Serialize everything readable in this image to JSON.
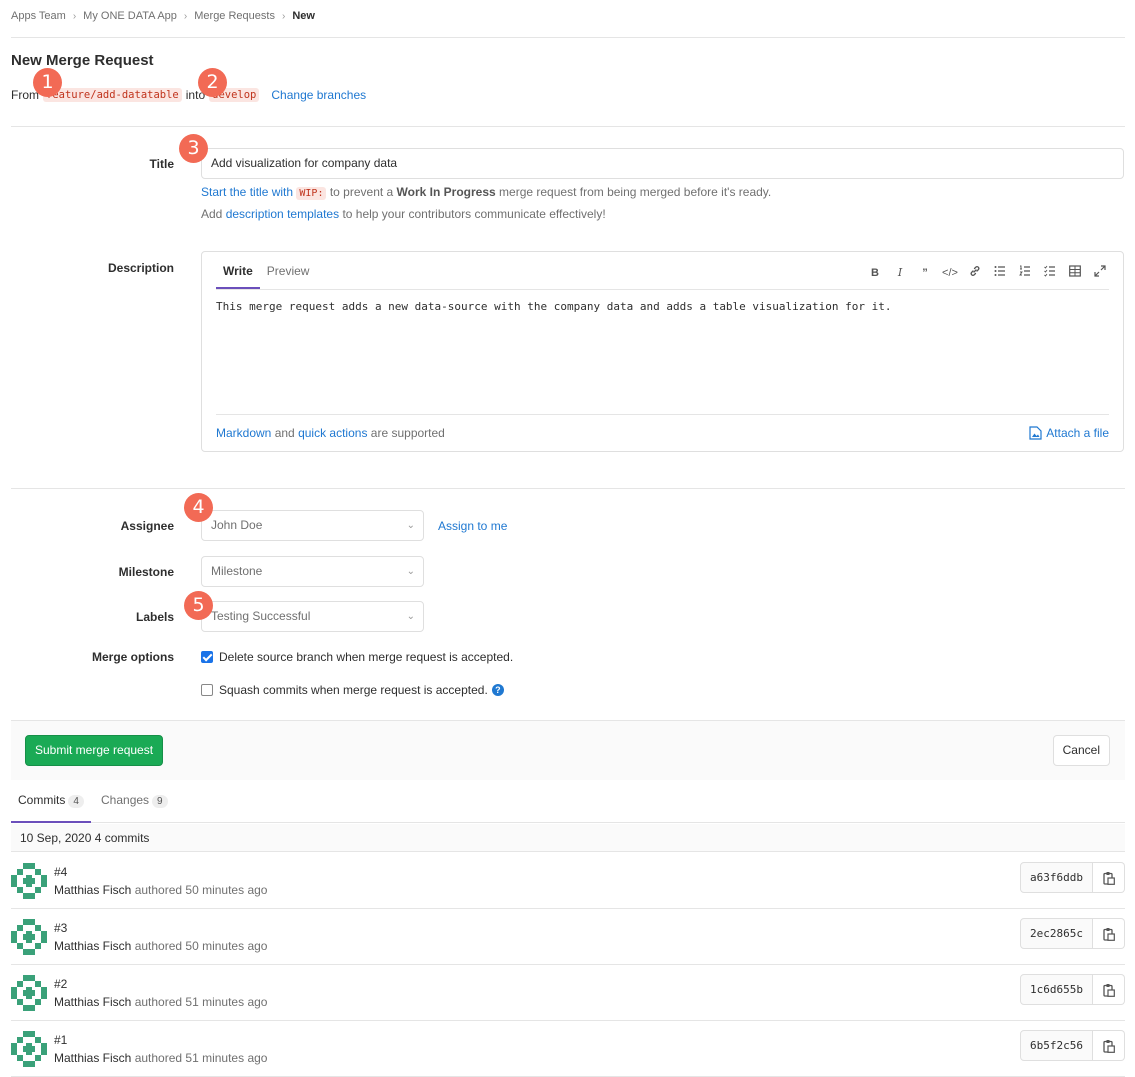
{
  "breadcrumb": {
    "items": [
      "Apps Team",
      "My ONE DATA App",
      "Merge Requests"
    ],
    "current": "New"
  },
  "header": {
    "title": "New Merge Request",
    "from_label": "From",
    "source_branch": "feature/add-datatable",
    "into_label": "into",
    "target_branch": "develop",
    "change_branches": "Change branches"
  },
  "form": {
    "title_label": "Title",
    "title_value": "Add visualization for company data",
    "hint1_link": "Start the title with",
    "hint1_code": "WIP:",
    "hint1_mid": "to prevent a",
    "hint1_bold": "Work In Progress",
    "hint1_tail": "merge request from being merged before it's ready.",
    "hint2_pre": "Add",
    "hint2_link": "description templates",
    "hint2_tail": "to help your contributors communicate effectively!",
    "description_label": "Description",
    "tab_write": "Write",
    "tab_preview": "Preview",
    "description_text": "This merge request adds a new data-source with the company data and adds a table visualization for it.",
    "footer_markdown": "Markdown",
    "footer_and": "and",
    "footer_quick": "quick actions",
    "footer_tail": "are supported",
    "attach": "Attach a file",
    "assignee_label": "Assignee",
    "assignee_value": "John Doe",
    "assign_to_me": "Assign to me",
    "milestone_label": "Milestone",
    "milestone_value": "Milestone",
    "labels_label": "Labels",
    "labels_value": "Testing Successful",
    "merge_options_label": "Merge options",
    "option_delete": "Delete source branch when merge request is accepted.",
    "option_delete_checked": true,
    "option_squash": "Squash commits when merge request is accepted.",
    "option_squash_checked": false
  },
  "actions": {
    "submit": "Submit merge request",
    "cancel": "Cancel"
  },
  "tabs": [
    {
      "label": "Commits",
      "count": "4"
    },
    {
      "label": "Changes",
      "count": "9"
    }
  ],
  "commits": {
    "day_header": "10 Sep, 2020 4 commits",
    "items": [
      {
        "title": "#4",
        "author": "Matthias Fisch",
        "meta": "authored 50 minutes ago",
        "sha": "a63f6ddb"
      },
      {
        "title": "#3",
        "author": "Matthias Fisch",
        "meta": "authored 50 minutes ago",
        "sha": "2ec2865c"
      },
      {
        "title": "#2",
        "author": "Matthias Fisch",
        "meta": "authored 51 minutes ago",
        "sha": "1c6d655b"
      },
      {
        "title": "#1",
        "author": "Matthias Fisch",
        "meta": "authored 51 minutes ago",
        "sha": "6b5f2c56"
      }
    ]
  },
  "markers": [
    "1",
    "2",
    "3",
    "4",
    "5"
  ],
  "colors": {
    "link": "#1f78d1",
    "submit_green": "#1aaa55",
    "marker": "#f26a55",
    "active_tab": "#6b4fbb",
    "code_chip_bg": "#fbe5e1",
    "code_chip_text": "#c0341d"
  }
}
